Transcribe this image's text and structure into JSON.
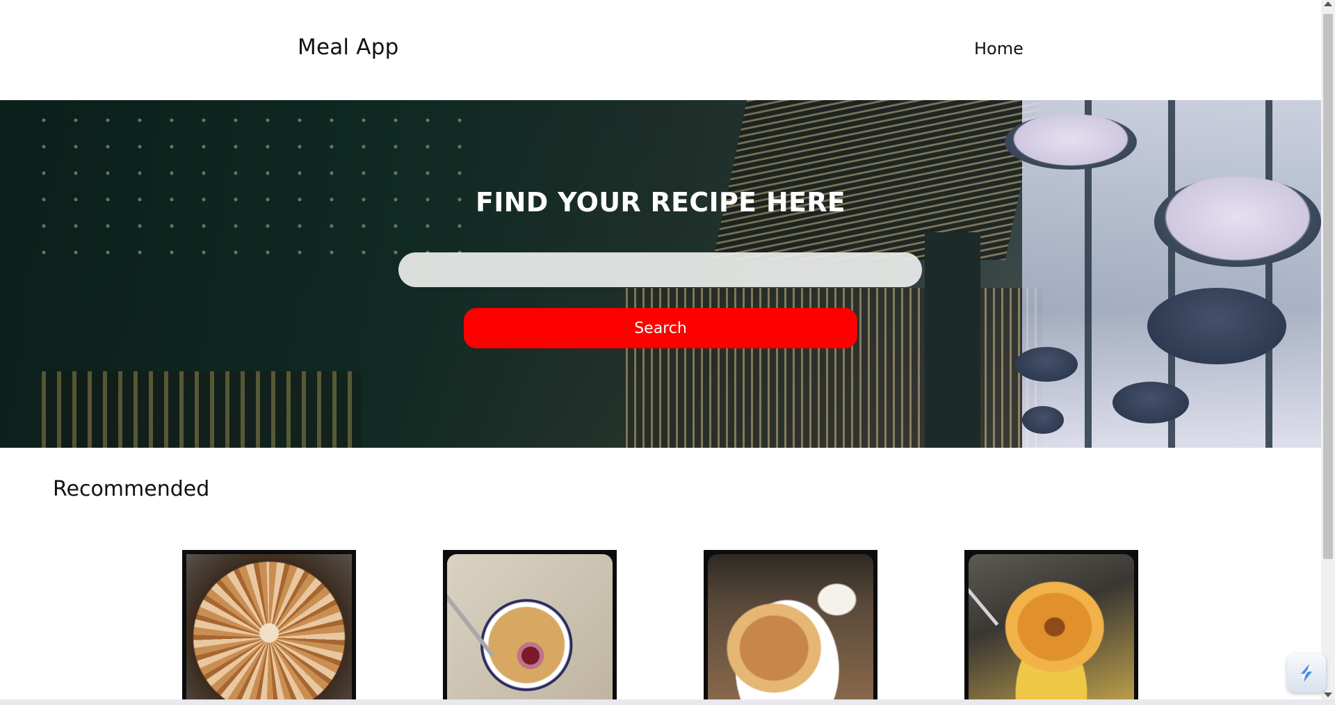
{
  "header": {
    "brand": "Meal App",
    "nav": {
      "home_label": "Home"
    }
  },
  "hero": {
    "title": "FIND YOUR RECIPE HERE",
    "search": {
      "value": "",
      "placeholder": ""
    },
    "search_button_label": "Search"
  },
  "recommended": {
    "title": "Recommended",
    "cards": [
      {
        "image_subject": "apple tart"
      },
      {
        "image_subject": "berry crumble"
      },
      {
        "image_subject": "filled pancake"
      },
      {
        "image_subject": "fried fritter"
      }
    ]
  },
  "colors": {
    "search_button_bg": "#ff0000",
    "search_button_text": "#ffffff",
    "hero_title": "#ffffff",
    "card_frame": "#0c0c0c"
  },
  "icons": {
    "floating_widget": "app-launcher-icon"
  }
}
